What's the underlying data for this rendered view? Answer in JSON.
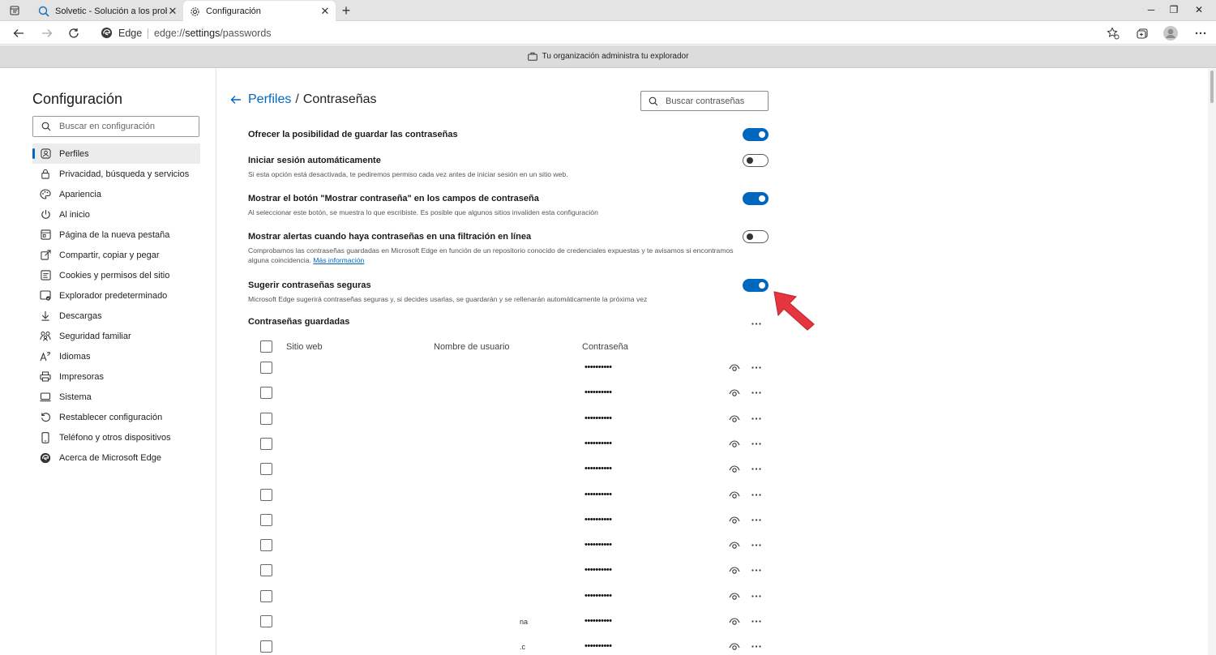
{
  "browser": {
    "tabs": [
      {
        "title": "Solvetic - Solución a los problem",
        "active": false,
        "icon": "solvetic-favicon-icon"
      },
      {
        "title": "Configuración",
        "active": true,
        "icon": "gear-icon"
      }
    ],
    "address": {
      "brand": "Edge",
      "url_prefix": "edge://",
      "url_host": "settings",
      "url_path": "/passwords"
    },
    "infobar_text": "Tu organización administra tu explorador"
  },
  "sidebar": {
    "title": "Configuración",
    "search_placeholder": "Buscar en configuración",
    "items": [
      {
        "label": "Perfiles",
        "icon": "profile-icon",
        "active": true
      },
      {
        "label": "Privacidad, búsqueda y servicios",
        "icon": "lock-icon"
      },
      {
        "label": "Apariencia",
        "icon": "appearance-icon"
      },
      {
        "label": "Al inicio",
        "icon": "power-icon"
      },
      {
        "label": "Página de la nueva pestaña",
        "icon": "newtab-icon"
      },
      {
        "label": "Compartir, copiar y pegar",
        "icon": "share-icon"
      },
      {
        "label": "Cookies y permisos del sitio",
        "icon": "cookie-icon"
      },
      {
        "label": "Explorador predeterminado",
        "icon": "browser-icon"
      },
      {
        "label": "Descargas",
        "icon": "download-icon"
      },
      {
        "label": "Seguridad familiar",
        "icon": "family-icon"
      },
      {
        "label": "Idiomas",
        "icon": "language-icon"
      },
      {
        "label": "Impresoras",
        "icon": "printer-icon"
      },
      {
        "label": "Sistema",
        "icon": "system-icon"
      },
      {
        "label": "Restablecer configuración",
        "icon": "reset-icon"
      },
      {
        "label": "Teléfono y otros dispositivos",
        "icon": "phone-icon"
      },
      {
        "label": "Acerca de Microsoft Edge",
        "icon": "edge-logo-icon"
      }
    ]
  },
  "main": {
    "breadcrumb": {
      "parent": "Perfiles",
      "separator": "/",
      "current": "Contraseñas"
    },
    "search_placeholder": "Buscar contraseñas",
    "settings": [
      {
        "title": "Ofrecer la posibilidad de guardar las contraseñas",
        "desc": "",
        "on": true
      },
      {
        "title": "Iniciar sesión automáticamente",
        "desc": "Si esta opción está desactivada, te pediremos permiso cada vez antes de iniciar sesión en un sitio web.",
        "on": false
      },
      {
        "title": "Mostrar el botón \"Mostrar contraseña\" en los campos de contraseña",
        "desc": "Al seleccionar este botón, se muestra lo que escribiste. Es posible que algunos sitios invaliden esta configuración",
        "on": true
      },
      {
        "title": "Mostrar alertas cuando haya contraseñas en una filtración en línea",
        "desc": "Comprobamos las contraseñas guardadas en Microsoft Edge en función de un repositorio conocido de credenciales expuestas y te avisamos si encontramos alguna coincidencia.",
        "link": "Más información",
        "on": false
      },
      {
        "title": "Sugerir contraseñas seguras",
        "desc": "Microsoft Edge sugerirá contraseñas seguras y, si decides usarlas, se guardarán y se rellenarán automáticamente la próxima vez",
        "on": true
      }
    ],
    "saved_title": "Contraseñas guardadas",
    "columns": {
      "site": "Sitio web",
      "user": "Nombre de usuario",
      "password": "Contraseña"
    },
    "rows": [
      {
        "site": "",
        "password": "••••••••••"
      },
      {
        "site": "",
        "password": "••••••••••"
      },
      {
        "site": "",
        "password": "••••••••••"
      },
      {
        "site": "",
        "password": "••••••••••"
      },
      {
        "site": "",
        "password": "••••••••••"
      },
      {
        "site": "",
        "password": "••••••••••"
      },
      {
        "site": "",
        "password": "••••••••••"
      },
      {
        "site": "",
        "password": "••••••••••"
      },
      {
        "site": "",
        "password": "••••••••••"
      },
      {
        "site": "",
        "password": "••••••••••"
      },
      {
        "site": "na",
        "password": "••••••••••"
      },
      {
        "site": ".c",
        "password": "••••••••••"
      }
    ]
  },
  "colors": {
    "accent": "#0067c0",
    "pointer_arrow": "#e4363f"
  }
}
